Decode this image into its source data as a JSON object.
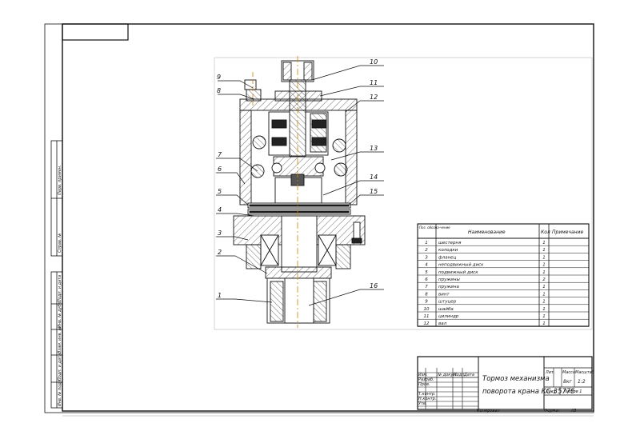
{
  "callouts": [
    "1",
    "2",
    "3",
    "4",
    "5",
    "6",
    "7",
    "8",
    "9",
    "10",
    "11",
    "12",
    "13",
    "14",
    "15",
    "16"
  ],
  "bom": {
    "headers": {
      "pos": "Поз. обозна-чение",
      "name": "Наименование",
      "qty": "Кол",
      "note": "Примечание"
    },
    "rows": [
      {
        "pos": "1",
        "name": "шестерня",
        "qty": "1"
      },
      {
        "pos": "2",
        "name": "колодки",
        "qty": "1"
      },
      {
        "pos": "3",
        "name": "фланец",
        "qty": "1"
      },
      {
        "pos": "4",
        "name": "неподвижный диск",
        "qty": "1"
      },
      {
        "pos": "5",
        "name": "подвижный диск",
        "qty": "1"
      },
      {
        "pos": "6",
        "name": "пружины",
        "qty": "2"
      },
      {
        "pos": "7",
        "name": "пружина",
        "qty": "1"
      },
      {
        "pos": "8",
        "name": "винт",
        "qty": "1"
      },
      {
        "pos": "9",
        "name": "штуцер",
        "qty": "1"
      },
      {
        "pos": "10",
        "name": "шайба",
        "qty": "1"
      },
      {
        "pos": "11",
        "name": "цилиндр",
        "qty": "1"
      },
      {
        "pos": "12",
        "name": "вал",
        "qty": "1"
      }
    ]
  },
  "title_block": {
    "title_line1": "Тормоз механизма",
    "title_line2": "поворота крана КС-3577б",
    "lit": "Лит.",
    "mass": "Масса",
    "scale": "Масштаб",
    "mass_value": "8кг",
    "scale_value": "1:2",
    "sheet": "Лист",
    "sheets": "Листов 1",
    "sheet_num": "1",
    "row_labels": [
      "Изм.",
      "Разраб.",
      "Пров.",
      "Т.контр.",
      "Н.контр.",
      "Утв."
    ],
    "col_labels": [
      "№ докум.",
      "Подп.",
      "Дата"
    ]
  },
  "side_stamp": [
    "Перв. примен.",
    "Справ. №",
    "Подп. и дата",
    "Инв. № дубл.",
    "Взам. инв. №",
    "Подп. и дата",
    "Инв. № подл."
  ],
  "footer": {
    "copied": "Копировал",
    "format": "Формат",
    "format_value": "А3"
  }
}
